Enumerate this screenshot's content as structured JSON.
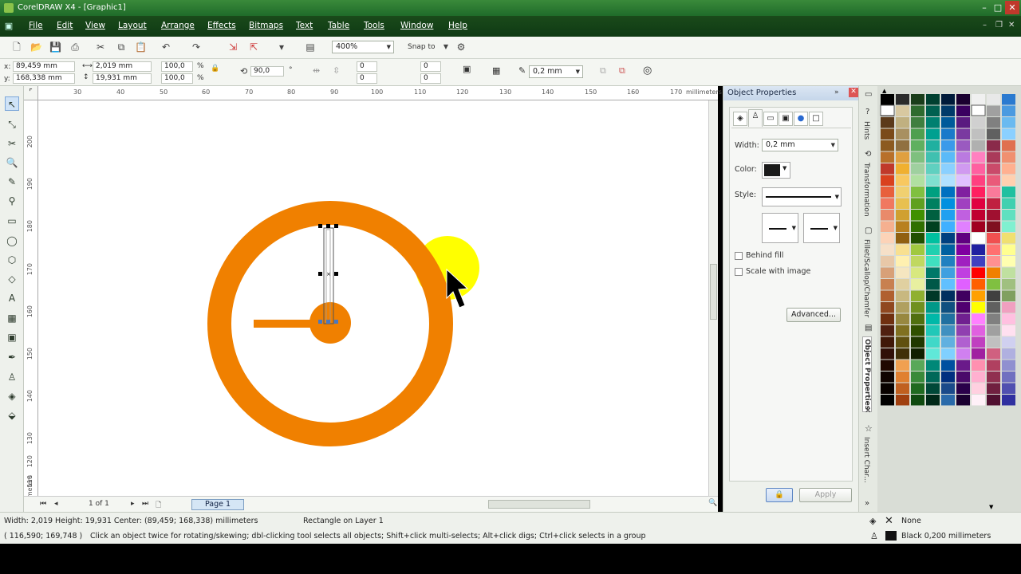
{
  "window": {
    "title": "CorelDRAW X4 - [Graphic1]"
  },
  "menu": [
    "File",
    "Edit",
    "View",
    "Layout",
    "Arrange",
    "Effects",
    "Bitmaps",
    "Text",
    "Table",
    "Tools",
    "Window",
    "Help"
  ],
  "toolbar": {
    "zoom": "400%",
    "snap_to": "Snap to"
  },
  "property_bar": {
    "x": "89,459 mm",
    "y": "168,338 mm",
    "width": "2,019 mm",
    "height": "19,931 mm",
    "scale_x": "100,0",
    "scale_y": "100,0",
    "percent": "%",
    "rotation": "90,0",
    "degree": "°",
    "corner1": "0",
    "corner2": "0",
    "corner3": "0",
    "corner4": "0",
    "outline_width": "0,2 mm",
    "x_label": "x:",
    "y_label": "y:"
  },
  "ruler": {
    "h_ticks": [
      "30",
      "40",
      "50",
      "60",
      "70",
      "80",
      "90",
      "100",
      "110",
      "120",
      "130",
      "140",
      "150",
      "160",
      "170"
    ],
    "unit": "millimeters",
    "v_ticks": [
      "200",
      "190",
      "180",
      "170",
      "160",
      "150",
      "140",
      "130",
      "120",
      "110"
    ],
    "v_unit": "millimeters"
  },
  "page_nav": {
    "counter": "1 of 1",
    "page_tab": "Page 1"
  },
  "docker": {
    "title": "Object Properties",
    "width_label": "Width:",
    "width_value": "0,2 mm",
    "color_label": "Color:",
    "style_label": "Style:",
    "behind_fill": "Behind fill",
    "scale_with_image": "Scale with image",
    "advanced_button": "Advanced...",
    "apply_button": "Apply"
  },
  "side_tabs": [
    "Hints",
    "Transformation",
    "Fillet/Scallop/Chamfer",
    "Object Properties",
    "Insert Char..."
  ],
  "status": {
    "dimensions": "Width: 2,019  Height: 19,931  Center: (89,459; 168,338)  millimeters",
    "selection": "Rectangle on Layer 1",
    "coords": "( 116,590; 169,748 )",
    "hint": "Click an object twice for rotating/skewing; dbl-clicking tool selects all objects; Shift+click multi-selects; Alt+click digs; Ctrl+click selects in a group",
    "fill": "None",
    "outline": "Black  0,200 millimeters"
  },
  "colors": {
    "orange": "#f08000",
    "yellow": "#ffff00",
    "title_bar": "#2a7a30",
    "menu_bar": "#14401a"
  }
}
